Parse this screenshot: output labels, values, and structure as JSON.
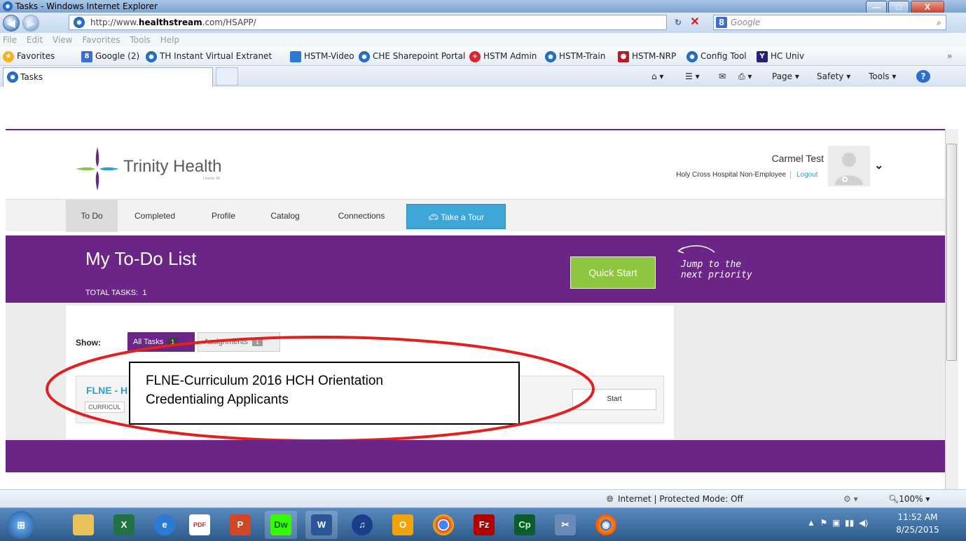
{
  "window": {
    "title": "Tasks - Windows Internet Explorer",
    "minimize": "—",
    "maximize": "□",
    "close": "X"
  },
  "address": {
    "prefix": "http://www.",
    "domain": "healthstream",
    "suffix": ".com/HSAPP/",
    "back": "◀",
    "forward": "▶"
  },
  "search": {
    "placeholder": "Google",
    "badge": "8"
  },
  "menu": [
    "File",
    "Edit",
    "View",
    "Favorites",
    "Tools",
    "Help"
  ],
  "favorites": {
    "label": "Favorites",
    "items": [
      "Google (2)",
      "TH Instant Virtual Extranet",
      "HSTM-Video",
      "CHE Sharepoint Portal",
      "HSTM Admin",
      "HSTM-Train",
      "HSTM-NRP",
      "Config Tool",
      "HC Univ"
    ]
  },
  "tab": {
    "title": "Tasks"
  },
  "commandbar": {
    "page": "Page ▾",
    "safety": "Safety ▾",
    "tools": "Tools ▾",
    "help": "?"
  },
  "site": {
    "logo_text": "Trinity Health",
    "logo_sub": "Livonia, MI",
    "user_name": "Carmel Test",
    "user_org": "Holy Cross Hospital Non-Employee",
    "logout": "Logout",
    "nav": {
      "todo": "To Do",
      "completed": "Completed",
      "profile": "Profile",
      "catalog": "Catalog",
      "connections": "Connections",
      "tour": "Take a Tour"
    },
    "page_title": "My To-Do List",
    "total_tasks_label": "TOTAL TASKS:",
    "total_tasks_count": "1",
    "quick_start": "Quick Start",
    "hint_line1": "Jump to the",
    "hint_line2": "next priority",
    "show_label": "Show:",
    "filter_all": "All Tasks",
    "filter_all_count": "1",
    "filter_assign": "Assignments",
    "filter_assign_count": "1",
    "task_title": "FLNE - H",
    "task_type": "CURRICUL",
    "start": "Start",
    "callout_line1": "FLNE-Curriculum 2016 HCH Orientation",
    "callout_line2": "Credentialing Applicants"
  },
  "status": {
    "zone": "Internet | Protected Mode: Off",
    "zoom": "100%"
  },
  "clock": {
    "time": "11:52 AM",
    "date": "8/25/2015"
  },
  "taskbar_apps": [
    "X",
    "e",
    "PDF",
    "P",
    "Dw",
    "W",
    "♫",
    "O",
    "●",
    "Fz",
    "Cp",
    "✂",
    "◉"
  ]
}
